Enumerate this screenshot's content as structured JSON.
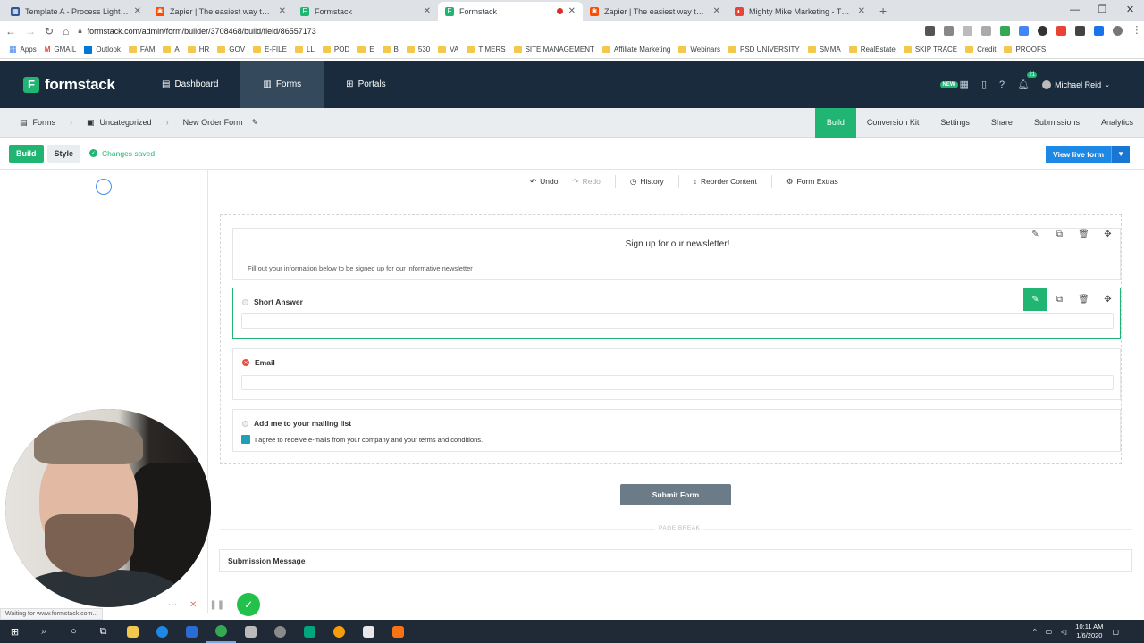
{
  "browser": {
    "tabs": [
      {
        "title": "Template A - Process Light - Mig",
        "fav_color": "#2b579a",
        "fav_glyph": "▦"
      },
      {
        "title": "Zapier | The easiest way to autom",
        "fav_color": "#ff4a00",
        "fav_glyph": "✱"
      },
      {
        "title": "Formstack",
        "fav_color": "#21b573",
        "fav_glyph": "F"
      },
      {
        "title": "Formstack",
        "fav_color": "#21b573",
        "fav_glyph": "F",
        "active": true,
        "recording": true
      },
      {
        "title": "Zapier | The easiest way to autom",
        "fav_color": "#ff4a00",
        "fav_glyph": "✱"
      },
      {
        "title": "Mighty Mike Marketing - The W",
        "fav_color": "#ea4335",
        "fav_glyph": "◐"
      }
    ],
    "new_tab": "+",
    "window_controls": {
      "minimize": "—",
      "maximize": "❐",
      "close": "✕"
    },
    "url": "formstack.com/admin/form/builder/3708468/build/field/86557173",
    "bookmarks": [
      "Apps",
      "GMAIL",
      "Outlook",
      "FAM",
      "A",
      "HR",
      "GOV",
      "E-FILE",
      "LL",
      "POD",
      "E",
      "B",
      "530",
      "VA",
      "TIMERS",
      "SITE MANAGEMENT",
      "Affiliate Marketing",
      "Webinars",
      "PSD UNIVERSITY",
      "SMMA",
      "RealEstate",
      "SKIP TRACE",
      "Credit",
      "PROOFS"
    ]
  },
  "app": {
    "logo": "formstack",
    "logo_mark": "F",
    "nav": [
      {
        "label": "Dashboard",
        "icon": "▤"
      },
      {
        "label": "Forms",
        "icon": "▥",
        "active": true
      },
      {
        "label": "Portals",
        "icon": "⊞"
      }
    ],
    "new_badge": "NEW",
    "notification_count": "21",
    "user_name": "Michael Reid"
  },
  "subbar": {
    "breadcrumbs": [
      "Forms",
      "Uncategorized",
      "New Order Form"
    ],
    "tabs": [
      {
        "label": "Build",
        "active": true
      },
      {
        "label": "Conversion Kit"
      },
      {
        "label": "Settings"
      },
      {
        "label": "Share"
      },
      {
        "label": "Submissions"
      },
      {
        "label": "Analytics"
      }
    ]
  },
  "buildbar": {
    "build": "Build",
    "style": "Style",
    "saved": "Changes saved",
    "view_live": "View live form"
  },
  "canvas_toolbar": {
    "undo": "Undo",
    "redo": "Redo",
    "history": "History",
    "reorder": "Reorder Content",
    "extras": "Form Extras"
  },
  "form": {
    "heading_title": "Sign up for our newsletter!",
    "heading_text": "Fill out your information below to be signed up for our informative newsletter",
    "fields": [
      {
        "label": "Short Answer"
      },
      {
        "label": "Email"
      },
      {
        "label": "Add me to your mailing list",
        "checkbox_text": "I agree to receive e-mails from your company and your terms and conditions."
      }
    ],
    "submit": "Submit Form",
    "page_break": "PAGE BREAK",
    "submission_message": "Submission Message"
  },
  "status": "Waiting for www.formstack.com...",
  "taskbar": {
    "time": "10:11 AM",
    "date": "1/6/2020"
  },
  "colors": {
    "brand_green": "#21b573",
    "header_navy": "#192b3d",
    "live_blue": "#1e88e5"
  }
}
